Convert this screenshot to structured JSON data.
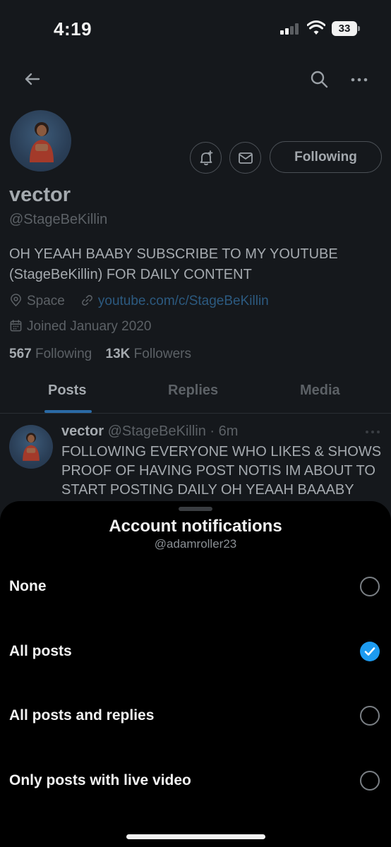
{
  "status_bar": {
    "time": "4:19",
    "battery": "33"
  },
  "profile": {
    "display_name": "vector",
    "handle": "@StageBeKillin",
    "bio": "OH YEAAH BAABY SUBSCRIBE TO MY YOUTUBE (StageBeKillin) FOR DAILY CONTENT",
    "location": "Space",
    "link": "youtube.com/c/StageBeKillin",
    "joined": "Joined January 2020",
    "following_count": "567",
    "following_label": "Following",
    "followers_count": "13K",
    "followers_label": "Followers",
    "follow_button": "Following"
  },
  "tabs": [
    {
      "label": "Posts",
      "active": true
    },
    {
      "label": "Replies",
      "active": false
    },
    {
      "label": "Media",
      "active": false
    }
  ],
  "tweet": {
    "name": "vector",
    "meta": "@StageBeKillin · 6m",
    "text": "FOLLOWING EVERYONE WHO LIKES & SHOWS PROOF OF HAVING POST NOTIS IM ABOUT TO START POSTING DAILY OH YEAAH BAAABY"
  },
  "sheet": {
    "title": "Account notifications",
    "subtitle": "@adamroller23",
    "options": [
      {
        "label": "None",
        "selected": false
      },
      {
        "label": "All posts",
        "selected": true
      },
      {
        "label": "All posts and replies",
        "selected": false
      },
      {
        "label": "Only posts with live video",
        "selected": false
      }
    ]
  },
  "colors": {
    "accent": "#1d9bf0",
    "sheet_background": "#000000",
    "dimmed_background": "#15181c"
  },
  "icons": [
    "back-arrow-icon",
    "search-icon",
    "more-icon",
    "bell-plus-icon",
    "mail-icon",
    "location-icon",
    "link-icon",
    "calendar-icon",
    "checkmark-icon"
  ]
}
